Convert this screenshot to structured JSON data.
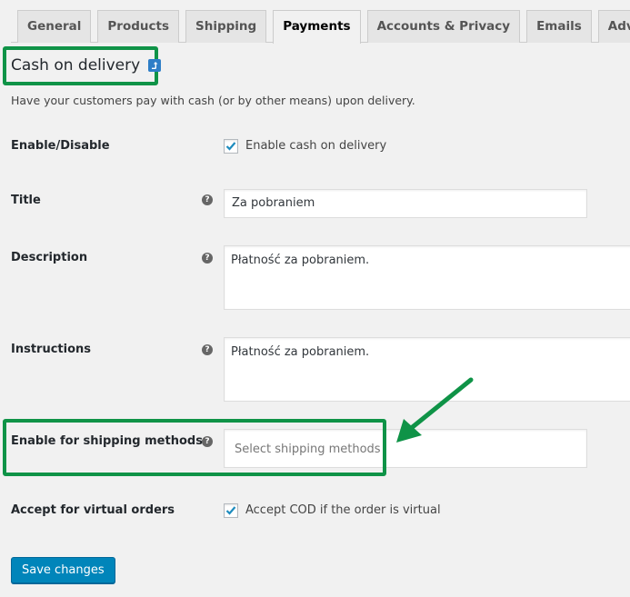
{
  "tabs": [
    {
      "label": "General",
      "active": false
    },
    {
      "label": "Products",
      "active": false
    },
    {
      "label": "Shipping",
      "active": false
    },
    {
      "label": "Payments",
      "active": true
    },
    {
      "label": "Accounts & Privacy",
      "active": false
    },
    {
      "label": "Emails",
      "active": false
    },
    {
      "label": "Advanced",
      "active": false
    }
  ],
  "heading": "Cash on delivery",
  "description": "Have your customers pay with cash (or by other means) upon delivery.",
  "fields": {
    "enable": {
      "label": "Enable/Disable",
      "checkbox_label": "Enable cash on delivery",
      "checked": true
    },
    "title": {
      "label": "Title",
      "value": "Za pobraniem"
    },
    "description": {
      "label": "Description",
      "value": "Płatność za pobraniem."
    },
    "instructions": {
      "label": "Instructions",
      "value": "Płatność za pobraniem."
    },
    "shipping_methods": {
      "label": "Enable for shipping methods",
      "placeholder": "Select shipping methods"
    },
    "virtual_orders": {
      "label": "Accept for virtual orders",
      "checkbox_label": "Accept COD if the order is virtual",
      "checked": true
    }
  },
  "save_label": "Save changes",
  "help_glyph": "?",
  "colors": {
    "highlight": "#0f9347",
    "primary_button": "#0085ba",
    "checkmark": "#1e8cbe"
  }
}
